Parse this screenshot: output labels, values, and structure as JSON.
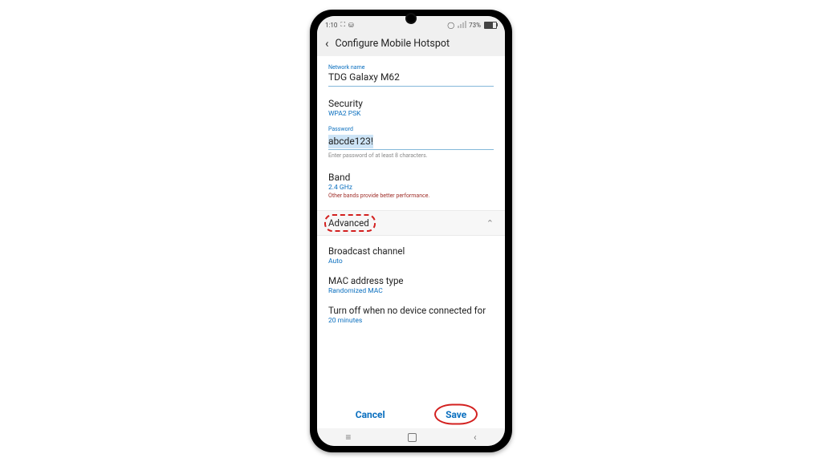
{
  "statusbar": {
    "time": "1:10",
    "battery": "73%"
  },
  "header": {
    "title": "Configure Mobile Hotspot"
  },
  "fields": {
    "networkNameLabel": "Network name",
    "networkNameValue": "TDG Galaxy M62",
    "securityLabel": "Security",
    "securityValue": "WPA2 PSK",
    "passwordLabel": "Password",
    "passwordValue": "abcde123!",
    "passwordHelper": "Enter password of at least 8 characters.",
    "bandLabel": "Band",
    "bandValue": "2.4 GHz",
    "bandHint": "Other bands provide better performance."
  },
  "advanced": {
    "label": "Advanced",
    "items": {
      "broadcastLabel": "Broadcast channel",
      "broadcastValue": "Auto",
      "macLabel": "MAC address type",
      "macValue": "Randomized MAC",
      "timeoutLabel": "Turn off when no device connected for",
      "timeoutValue": "20 minutes"
    }
  },
  "footer": {
    "cancel": "Cancel",
    "save": "Save"
  }
}
